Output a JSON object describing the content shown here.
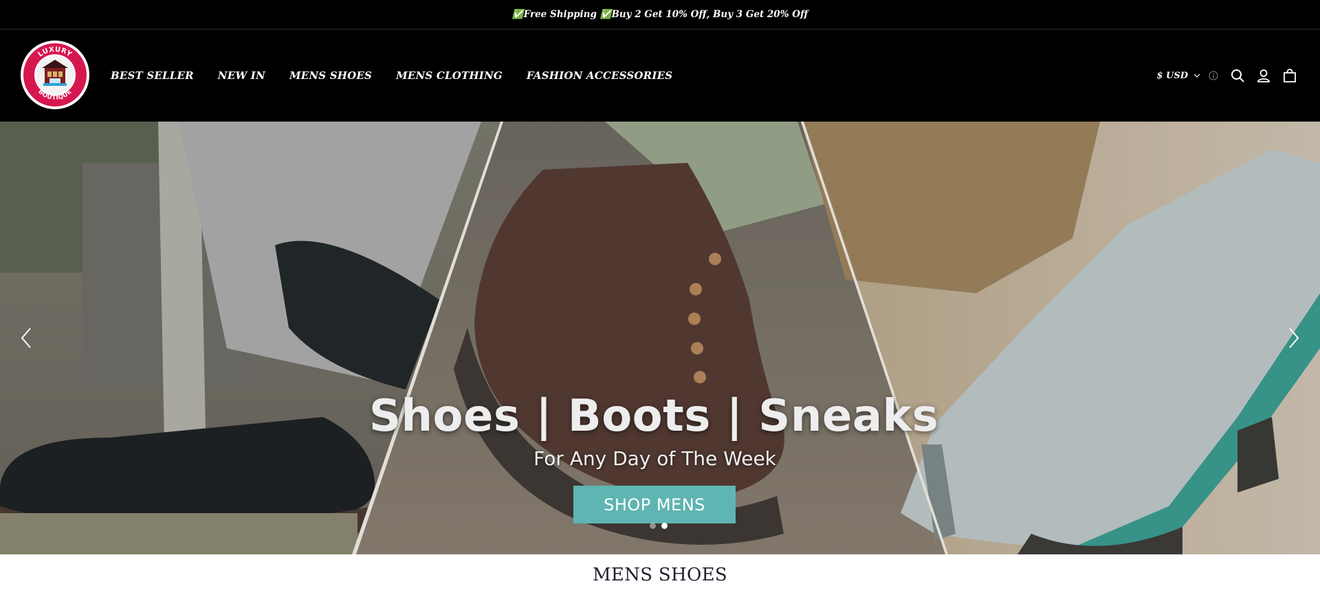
{
  "announcement": {
    "text": "✅Free Shipping ✅Buy 2 Get 10% Off, Buy 3 Get 20% Off"
  },
  "logo": {
    "top_text": "LUXURY",
    "bottom_text": "BOUTIQUE",
    "icon": "storefront-logo"
  },
  "nav": {
    "items": [
      {
        "label": "BEST SELLER"
      },
      {
        "label": "NEW IN"
      },
      {
        "label": "MENS SHOES"
      },
      {
        "label": "MENS CLOTHING"
      },
      {
        "label": "FASHION ACCESSORIES"
      }
    ]
  },
  "header_tools": {
    "currency": "$ USD",
    "icons": [
      "chevron-down-icon",
      "info-icon",
      "search-icon",
      "account-icon",
      "cart-icon"
    ]
  },
  "hero": {
    "headline": "Shoes | Boots | Sneaks",
    "subline": "For Any Day of The Week",
    "cta_label": "SHOP MENS",
    "slide_count": 2,
    "active_slide": 2,
    "icons": [
      "chevron-left-icon",
      "chevron-right-icon"
    ]
  },
  "section": {
    "title": "MENS SHOES"
  },
  "colors": {
    "header_bg": "#000000",
    "accent": "#5fb5b2",
    "logo_ring": "#d6174f"
  }
}
